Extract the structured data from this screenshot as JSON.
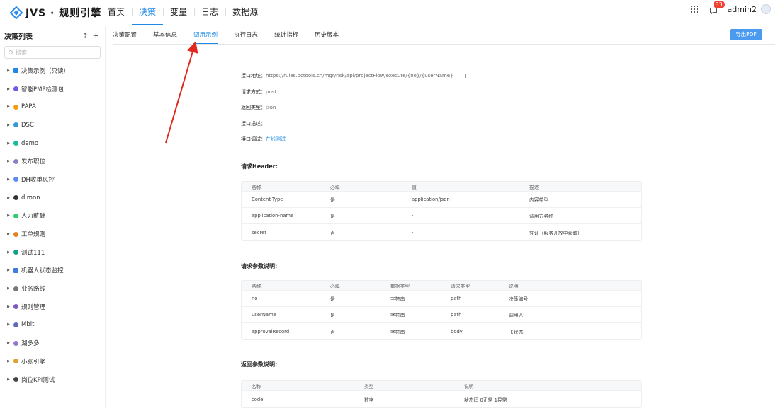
{
  "app": {
    "title": "JVS · 规则引擎"
  },
  "nav": [
    {
      "label": "首页",
      "active": false
    },
    {
      "label": "决策",
      "active": true
    },
    {
      "label": "变量",
      "active": false
    },
    {
      "label": "日志",
      "active": false
    },
    {
      "label": "数据源",
      "active": false
    }
  ],
  "header": {
    "badge_count": "33",
    "username": "admin2"
  },
  "sidebar": {
    "title": "决策列表",
    "search_placeholder": "搜索",
    "items": [
      {
        "label": "决策示例（只读）",
        "icon": "folder-icon",
        "color": "#1e88e5"
      },
      {
        "label": "智能PMP检测包",
        "icon": "circle-icon",
        "color": "#6c5ce7"
      },
      {
        "label": "PAPA",
        "icon": "circle-icon",
        "color": "#f39c12"
      },
      {
        "label": "DSC",
        "icon": "circle-icon",
        "color": "#3498db"
      },
      {
        "label": "demo",
        "icon": "circle-icon",
        "color": "#1abc9c"
      },
      {
        "label": "发布职位",
        "icon": "circle-icon",
        "color": "#8e7cc3"
      },
      {
        "label": "DH收单风控",
        "icon": "circle-icon",
        "color": "#5b8def"
      },
      {
        "label": "dimon",
        "icon": "branch-icon",
        "color": "#333333"
      },
      {
        "label": "人力薪酬",
        "icon": "circle-icon",
        "color": "#2ecc71"
      },
      {
        "label": "工单规则",
        "icon": "circle-icon",
        "color": "#e67e22"
      },
      {
        "label": "测试111",
        "icon": "circle-icon",
        "color": "#16a085"
      },
      {
        "label": "机器人状态监控",
        "icon": "square-icon",
        "color": "#3f7be0"
      },
      {
        "label": "业务路线",
        "icon": "list-icon",
        "color": "#777777"
      },
      {
        "label": "规则管理",
        "icon": "circle-icon",
        "color": "#7e57c2"
      },
      {
        "label": "Mbit",
        "icon": "circle-icon",
        "color": "#5c6bc0"
      },
      {
        "label": "湖多多",
        "icon": "circle-icon",
        "color": "#9575cd"
      },
      {
        "label": "小张引擎",
        "icon": "circle-icon",
        "color": "#e0a030"
      },
      {
        "label": "岗位KPI测试",
        "icon": "puzzle-icon",
        "color": "#444444"
      }
    ]
  },
  "tabs": [
    {
      "label": "决策配置",
      "active": false
    },
    {
      "label": "基本信息",
      "active": false
    },
    {
      "label": "调用示例",
      "active": true
    },
    {
      "label": "执行日志",
      "active": false
    },
    {
      "label": "统计指标",
      "active": false
    },
    {
      "label": "历史版本",
      "active": false
    }
  ],
  "export_label": "导出PDF",
  "api": {
    "url_label": "接口地址：",
    "url": "https://rules.bctools.cn/mgr/risk/api/projectFlow/execute/{no}/{userName}",
    "method_label": "请求方式：",
    "method": "post",
    "return_label": "返回类型：",
    "return_type": "json",
    "desc_label": "接口描述：",
    "debug_label": "接口调试：",
    "debug_link": "在线测试"
  },
  "header_section": {
    "title": "请求Header:",
    "columns": [
      "名称",
      "必填",
      "值",
      "描述"
    ],
    "rows": [
      [
        "Content-Type",
        "是",
        "application/json",
        "内容类型"
      ],
      [
        "application-name",
        "是",
        "-",
        "调用方名称"
      ],
      [
        "secret",
        "否",
        "-",
        "凭证（服务开放中获取）"
      ]
    ]
  },
  "params_section": {
    "title": "请求参数说明:",
    "columns": [
      "名称",
      "必填",
      "数据类型",
      "请求类型",
      "说明"
    ],
    "rows": [
      [
        "no",
        "是",
        "字符串",
        "path",
        "决策编号"
      ],
      [
        "userName",
        "是",
        "字符串",
        "path",
        "调用人"
      ],
      [
        "approvalRecord",
        "否",
        "字符串",
        "body",
        "卡状态"
      ]
    ]
  },
  "return_section": {
    "title": "返回参数说明:",
    "columns": [
      "名称",
      "类型",
      "说明"
    ],
    "rows": [
      [
        "code",
        "数字",
        "状态码 0正常 1异常"
      ]
    ]
  }
}
